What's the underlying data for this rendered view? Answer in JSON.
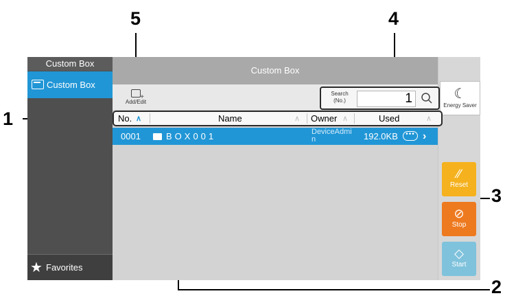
{
  "callouts": {
    "n5": "5",
    "n4": "4",
    "n1": "1",
    "n3": "3",
    "n2": "2"
  },
  "sidebar": {
    "header": "Custom Box",
    "item_label": "Custom Box",
    "favorites_label": "Favorites"
  },
  "main": {
    "title": "Custom Box",
    "add_edit_label": "Add/Edit",
    "search": {
      "label_line1": "Search",
      "label_line2": "(No.)",
      "value": "1"
    }
  },
  "table": {
    "columns": [
      "No.",
      "Name",
      "Owner",
      "Used"
    ],
    "row": {
      "no": "0001",
      "name": "BOX001",
      "owner_line1": "DeviceAdmi",
      "owner_line2": "n",
      "used": "192.0KB",
      "more": "•••"
    }
  },
  "right": {
    "energy_saver_label": "Energy Saver",
    "reset_label": "Reset",
    "stop_label": "Stop",
    "start_label": "Start"
  },
  "colors": {
    "accent": "#2196d6",
    "reset": "#f5b21e",
    "stop": "#ee7a20",
    "start": "#7fc2dc"
  }
}
